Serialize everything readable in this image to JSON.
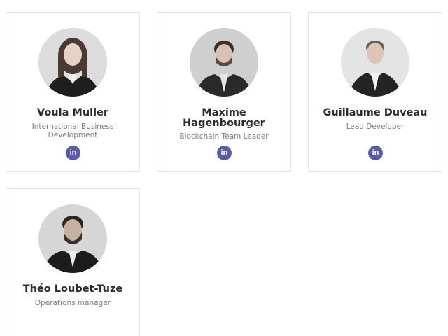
{
  "team": [
    {
      "name": "Voula Muller",
      "role": "International Business Development",
      "social": "in",
      "icon": "linkedin-icon"
    },
    {
      "name": "Maxime Hagenbourger",
      "role": "Blockchain Team Leader",
      "social": "in",
      "icon": "linkedin-icon"
    },
    {
      "name": "Guillaume Duveau",
      "role": "Lead Developer",
      "social": "in",
      "icon": "linkedin-icon"
    },
    {
      "name": "Théo Loubet-Tuze",
      "role": "Operations manager"
    }
  ],
  "colors": {
    "linkedin_bg": "#5a5aa8",
    "card_border": "#e2e2e2",
    "name_text": "#2b2b2b",
    "role_text": "#7a7a7a"
  }
}
